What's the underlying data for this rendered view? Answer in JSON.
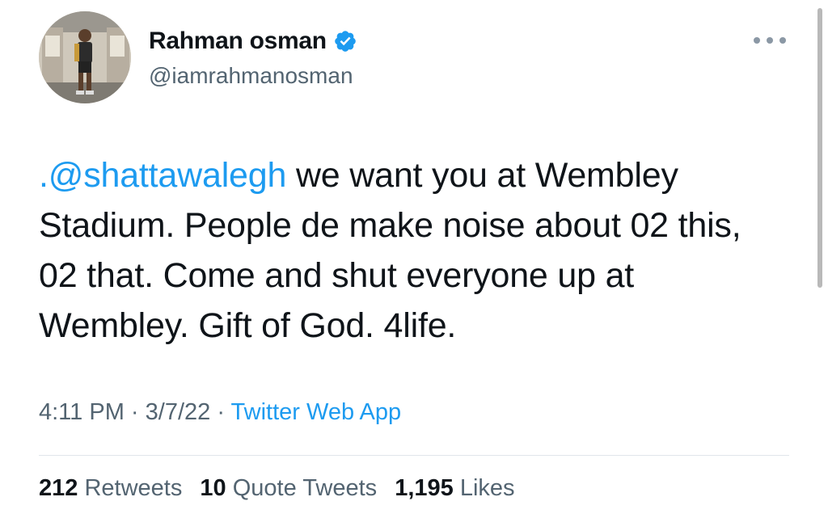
{
  "author": {
    "display_name": "Rahman osman",
    "handle": "@iamrahmanosman",
    "verified": true,
    "avatar": "profile-photo"
  },
  "tweet": {
    "mention": ".@shattawalegh",
    "text": " we want you at Wembley Stadium. People de make noise about 02 this, 02 that. Come and shut everyone up at Wembley. Gift of God. 4life."
  },
  "meta": {
    "time": "4:11 PM",
    "separator1": " · ",
    "date": "3/7/22",
    "separator2": " · ",
    "source": "Twitter Web App"
  },
  "stats": {
    "retweets_count": "212",
    "retweets_label": "Retweets",
    "quotes_count": "10",
    "quotes_label": "Quote Tweets",
    "likes_count": "1,195",
    "likes_label": "Likes"
  },
  "colors": {
    "accent": "#1d9bf0",
    "text": "#0f1419",
    "secondary": "#536471"
  },
  "icons": {
    "verified": "verified-badge-icon",
    "more": "more-options-icon"
  }
}
